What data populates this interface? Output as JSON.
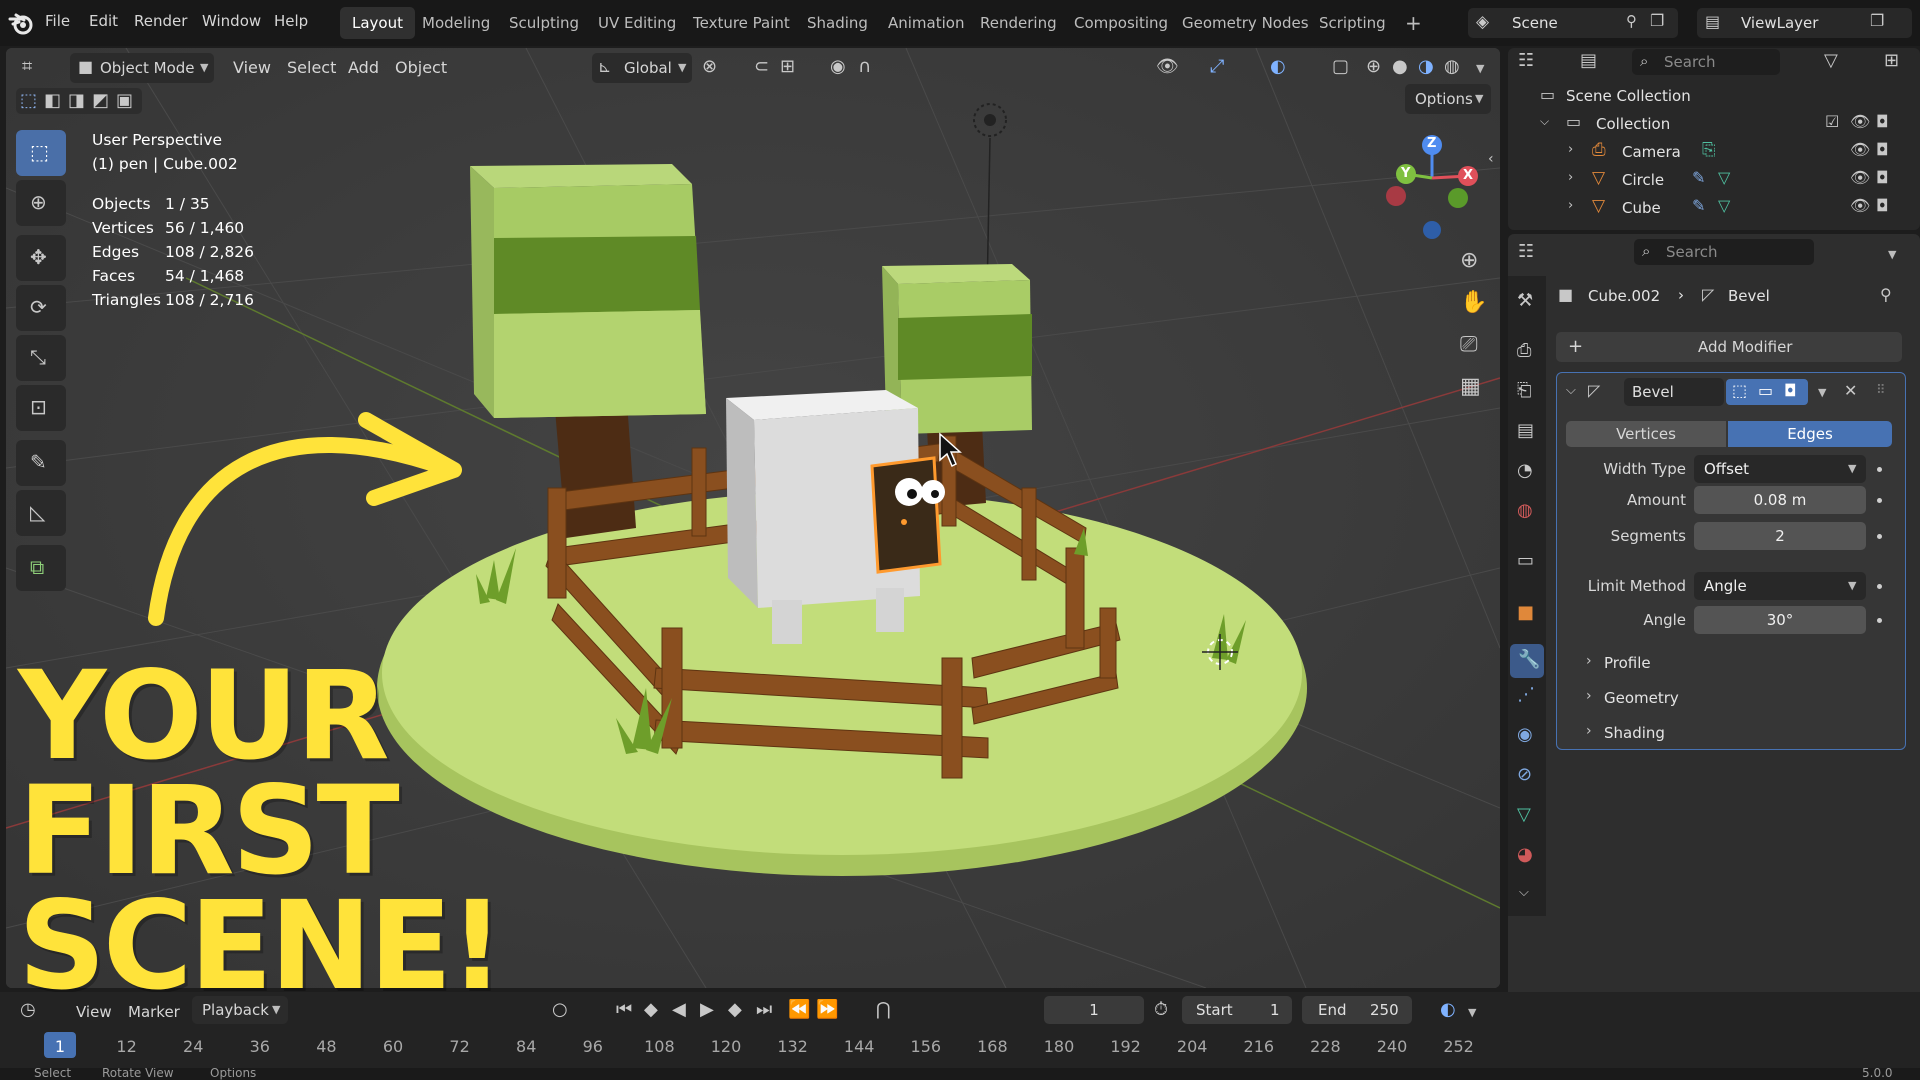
{
  "menubar": {
    "items": [
      "File",
      "Edit",
      "Render",
      "Window",
      "Help"
    ],
    "workspaces": [
      "Layout",
      "Modeling",
      "Sculpting",
      "UV Editing",
      "Texture Paint",
      "Shading",
      "Animation",
      "Rendering",
      "Compositing",
      "Geometry Nodes",
      "Scripting"
    ],
    "active_workspace": "Layout",
    "add_workspace": "+",
    "scene": "Scene",
    "view_layer": "ViewLayer"
  },
  "viewport_header": {
    "mode": "Object Mode",
    "menus": [
      "View",
      "Select",
      "Add",
      "Object"
    ],
    "transform_orientation": "Global",
    "options": "Options"
  },
  "overlay": {
    "perspective": "User Perspective",
    "context": "(1) pen | Cube.002",
    "stats": [
      {
        "label": "Objects",
        "value": "1 / 35"
      },
      {
        "label": "Vertices",
        "value": "56 / 1,460"
      },
      {
        "label": "Edges",
        "value": "108 / 2,826"
      },
      {
        "label": "Faces",
        "value": "54 / 1,468"
      },
      {
        "label": "Triangles",
        "value": "108 / 2,716"
      }
    ]
  },
  "gizmo": {
    "x": "X",
    "y": "Y",
    "z": "Z"
  },
  "headline": {
    "line1": "YOUR",
    "line2": "FIRST",
    "line3": "SCENE!"
  },
  "outliner": {
    "search_placeholder": "Search",
    "root": "Scene Collection",
    "collection": "Collection",
    "items": [
      "Camera",
      "Circle",
      "Cube"
    ]
  },
  "properties": {
    "search_placeholder": "Search",
    "breadcrumb_object": "Cube.002",
    "breadcrumb_modifier": "Bevel",
    "add_modifier": "Add Modifier",
    "modifier_name": "Bevel",
    "affect_options": [
      "Vertices",
      "Edges"
    ],
    "affect_selected": "Edges",
    "fields": [
      {
        "label": "Width Type",
        "value": "Offset",
        "kind": "dropdown"
      },
      {
        "label": "Amount",
        "value": "0.08 m",
        "kind": "number"
      },
      {
        "label": "Segments",
        "value": "2",
        "kind": "number"
      },
      {
        "label": "Limit Method",
        "value": "Angle",
        "kind": "dropdown"
      },
      {
        "label": "Angle",
        "value": "30°",
        "kind": "number"
      }
    ],
    "subpanels": [
      "Profile",
      "Geometry",
      "Shading"
    ]
  },
  "timeline": {
    "menus": [
      "View",
      "Marker",
      "Playback"
    ],
    "current_frame": "1",
    "start_label": "Start",
    "start": "1",
    "end_label": "End",
    "end": "250",
    "ticks": [
      "1",
      "12",
      "24",
      "36",
      "48",
      "60",
      "72",
      "84",
      "96",
      "108",
      "120",
      "132",
      "144",
      "156",
      "168",
      "180",
      "192",
      "204",
      "216",
      "228",
      "240",
      "252"
    ]
  },
  "statusbar": {
    "items": [
      "Select",
      "Rotate View",
      "Options"
    ],
    "version": "5.0.0"
  },
  "colors": {
    "accent": "#4772b3",
    "headline": "#ffe33a",
    "grass": "#b8d86b",
    "wood": "#8a4f1f"
  }
}
